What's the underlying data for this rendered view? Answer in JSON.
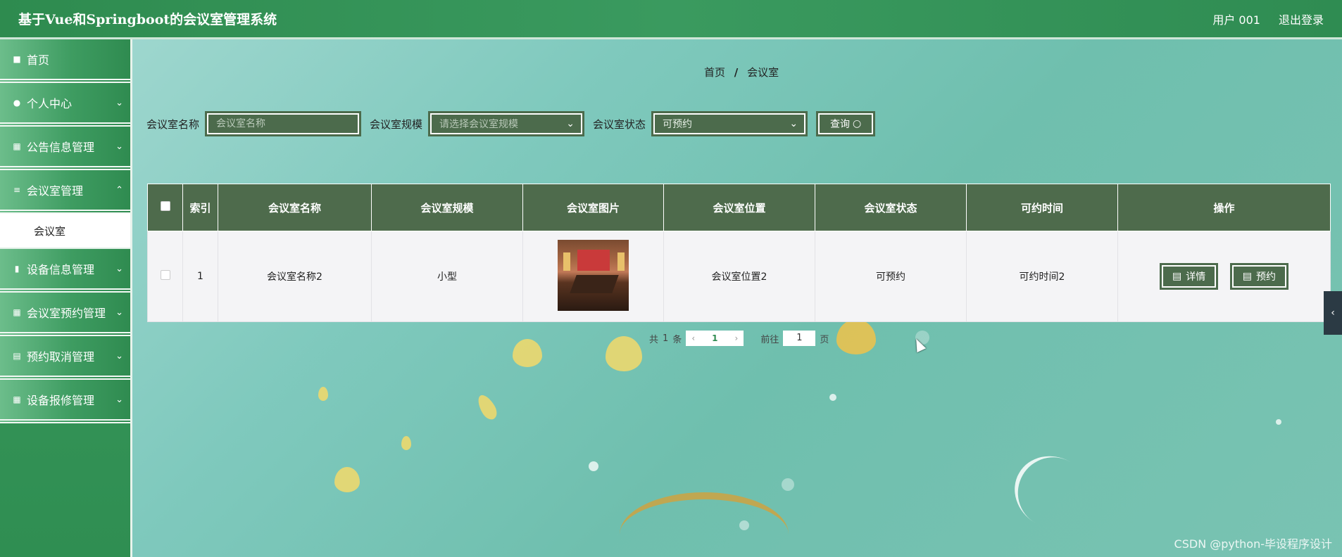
{
  "header": {
    "title": "基于Vue和Springboot的会议室管理系统",
    "user": "用户 001",
    "logout": "退出登录"
  },
  "sidebar": {
    "items": [
      {
        "label": "首页",
        "icon": "home-icon"
      },
      {
        "label": "个人中心",
        "icon": "user-icon"
      },
      {
        "label": "公告信息管理",
        "icon": "grid-icon"
      },
      {
        "label": "会议室管理",
        "icon": "menu-icon"
      },
      {
        "label": "设备信息管理",
        "icon": "chart-icon"
      },
      {
        "label": "会议室预约管理",
        "icon": "grid-icon"
      },
      {
        "label": "预约取消管理",
        "icon": "clipboard-icon"
      },
      {
        "label": "设备报修管理",
        "icon": "grid-icon"
      }
    ],
    "submenu": {
      "label": "会议室"
    }
  },
  "breadcrumb": {
    "home": "首页",
    "separator": "/",
    "current": "会议室"
  },
  "search": {
    "name_label": "会议室名称",
    "name_placeholder": "会议室名称",
    "scale_label": "会议室规模",
    "scale_placeholder": "请选择会议室规模",
    "status_label": "会议室状态",
    "status_value": "可预约",
    "query_button": "查询"
  },
  "table": {
    "headers": [
      "索引",
      "会议室名称",
      "会议室规模",
      "会议室图片",
      "会议室位置",
      "会议室状态",
      "可约时间",
      "操作"
    ],
    "rows": [
      {
        "index": "1",
        "name": "会议室名称2",
        "scale": "小型",
        "location": "会议室位置2",
        "status": "可预约",
        "time": "可约时间2",
        "detail_button": "详情",
        "book_button": "预约"
      }
    ]
  },
  "pagination": {
    "total_prefix": "共",
    "total": "1",
    "total_suffix": "条",
    "current_page": "1",
    "goto_label": "前往",
    "goto_value": "1",
    "page_suffix": "页"
  },
  "watermark": "CSDN @python-毕设程序设计",
  "colors": {
    "header": "#2e8b4f",
    "table_header": "#4e6b4c",
    "button": "#4c6b4c"
  }
}
